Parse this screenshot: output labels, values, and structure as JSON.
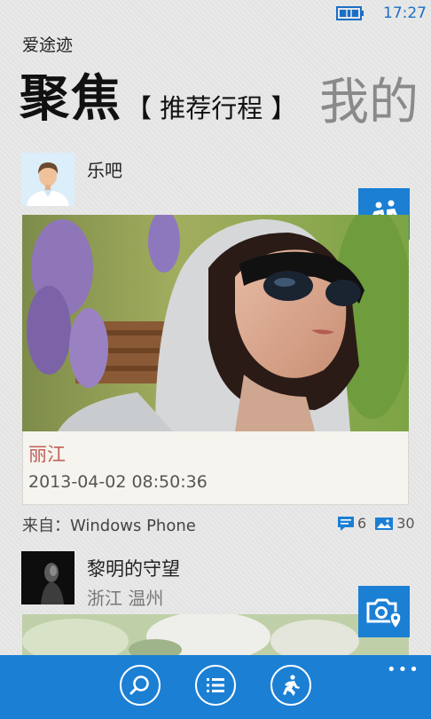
{
  "status": {
    "time": "17:27"
  },
  "app": {
    "title": "爱途迹"
  },
  "pivot": {
    "active": "聚焦",
    "active_sub": "【 推荐行程 】",
    "next": "我的"
  },
  "posts": [
    {
      "user": "乐吧",
      "place": "丽江",
      "datetime": "2013-04-02 08:50:36",
      "source": "来自：Windows Phone",
      "comments": "6",
      "photos": "30"
    },
    {
      "user": "黎明的守望",
      "location": "浙江 温州"
    }
  ],
  "appbar": {
    "more": "•••"
  },
  "icons": [
    "battery-icon",
    "person-avatar-icon",
    "walking-people-icon",
    "comment-icon",
    "photo-icon",
    "camera-location-icon",
    "search-icon",
    "list-icon",
    "runner-icon"
  ],
  "colors": {
    "accent": "#1b7fd4",
    "place": "#c2605a",
    "time": "#1b6fc6"
  }
}
